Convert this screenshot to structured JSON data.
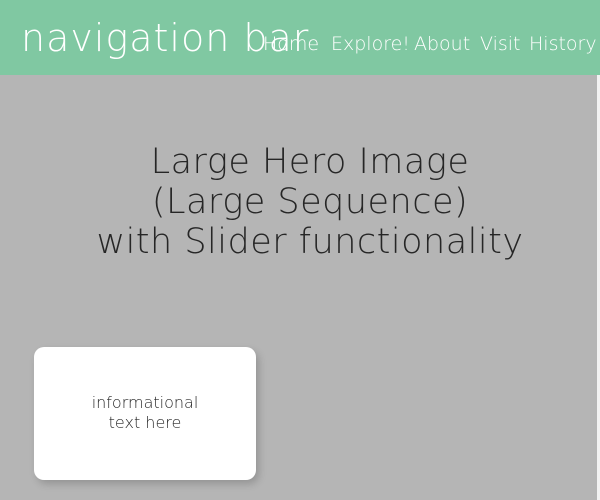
{
  "navbar": {
    "brand": "navigation bar",
    "links": [
      "Home",
      "Explore!",
      "About",
      "Visit",
      "History"
    ],
    "color": "#80c8a2"
  },
  "hero": {
    "lines": [
      "Large Hero Image",
      "(Large Sequence)",
      "with Slider functionality"
    ],
    "background": "#b5b5b5"
  },
  "info_card": {
    "lines": [
      "informational",
      "text here"
    ]
  }
}
